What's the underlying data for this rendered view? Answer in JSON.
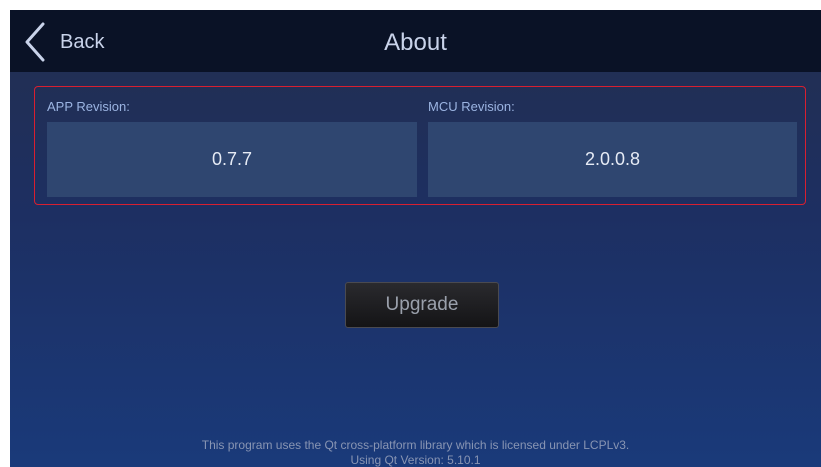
{
  "header": {
    "back_label": "Back",
    "title": "About",
    "back_icon": "chevron-left-icon"
  },
  "revisions": {
    "app": {
      "label": "APP Revision:",
      "value": "0.7.7"
    },
    "mcu": {
      "label": "MCU Revision:",
      "value": "2.0.0.8"
    }
  },
  "actions": {
    "upgrade_label": "Upgrade"
  },
  "footer": {
    "license_line": "This program uses the Qt cross-platform library which is licensed under LCPLv3.",
    "version_line": "Using Qt Version: 5.10.1"
  },
  "colors": {
    "header_bg": "#0a1226",
    "panel_border": "#d81f30",
    "value_box": "#2f4670",
    "label_text": "#9bb4e2"
  }
}
